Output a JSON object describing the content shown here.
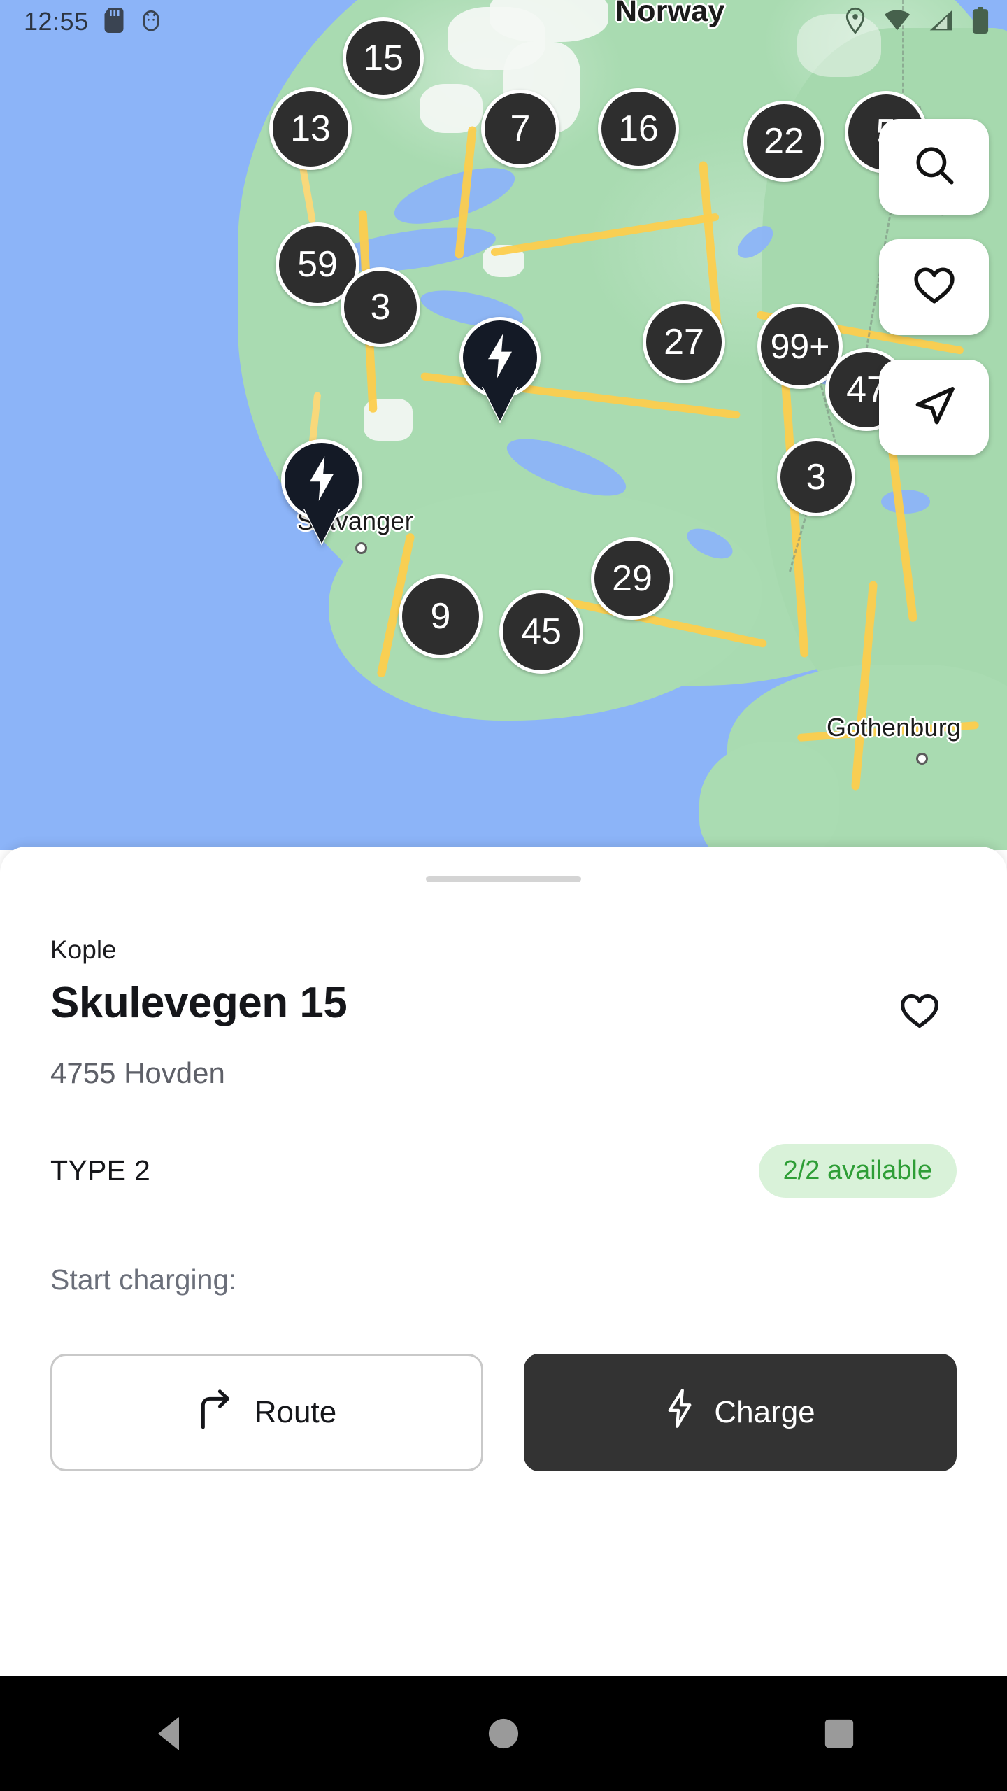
{
  "status_bar": {
    "time": "12:55",
    "left_icons": [
      "sd-card-icon",
      "android-debug-icon"
    ],
    "right_icons": [
      "location-pin-icon",
      "wifi-icon",
      "cellular-signal-icon",
      "battery-icon"
    ]
  },
  "map": {
    "water_color": "#8cb4f8",
    "land_color": "#aadcb2",
    "road_color": "#fccd4d",
    "labels": [
      {
        "text": "Norway",
        "type": "country"
      },
      {
        "text": "Stavanger",
        "type": "city"
      },
      {
        "text": "Gothenburg",
        "type": "city"
      }
    ],
    "clusters": [
      {
        "count": "15"
      },
      {
        "count": "13"
      },
      {
        "count": "7"
      },
      {
        "count": "16"
      },
      {
        "count": "22"
      },
      {
        "count": "5"
      },
      {
        "count": "59"
      },
      {
        "count": "3"
      },
      {
        "count": "27"
      },
      {
        "count": "99+"
      },
      {
        "count": "47"
      },
      {
        "count": "3"
      },
      {
        "count": "29"
      },
      {
        "count": "9"
      },
      {
        "count": "45"
      }
    ],
    "pins": [
      {
        "name": "selected-station-pin",
        "icon": "bolt-icon"
      },
      {
        "name": "station-pin",
        "icon": "bolt-icon"
      }
    ],
    "controls": [
      {
        "name": "search-icon",
        "label": "Search"
      },
      {
        "name": "heart-icon",
        "label": "Favorites"
      },
      {
        "name": "navigate-icon",
        "label": "My location"
      }
    ]
  },
  "sheet": {
    "handle": "drag-handle",
    "provider": "Kople",
    "title": "Skulevegen 15",
    "address": "4755 Hovden",
    "favorite_icon": "heart-icon",
    "connector": {
      "type": "TYPE 2",
      "availability": "2/2 available",
      "availability_bg": "#d9f2d9",
      "availability_color": "#2e9e36"
    },
    "start_charging_label": "Start charging:",
    "buttons": {
      "route": {
        "label": "Route",
        "icon": "turn-right-icon"
      },
      "charge": {
        "label": "Charge",
        "icon": "bolt-icon"
      }
    }
  },
  "navbar": {
    "back": "back-button",
    "home": "home-button",
    "recents": "recents-button"
  }
}
